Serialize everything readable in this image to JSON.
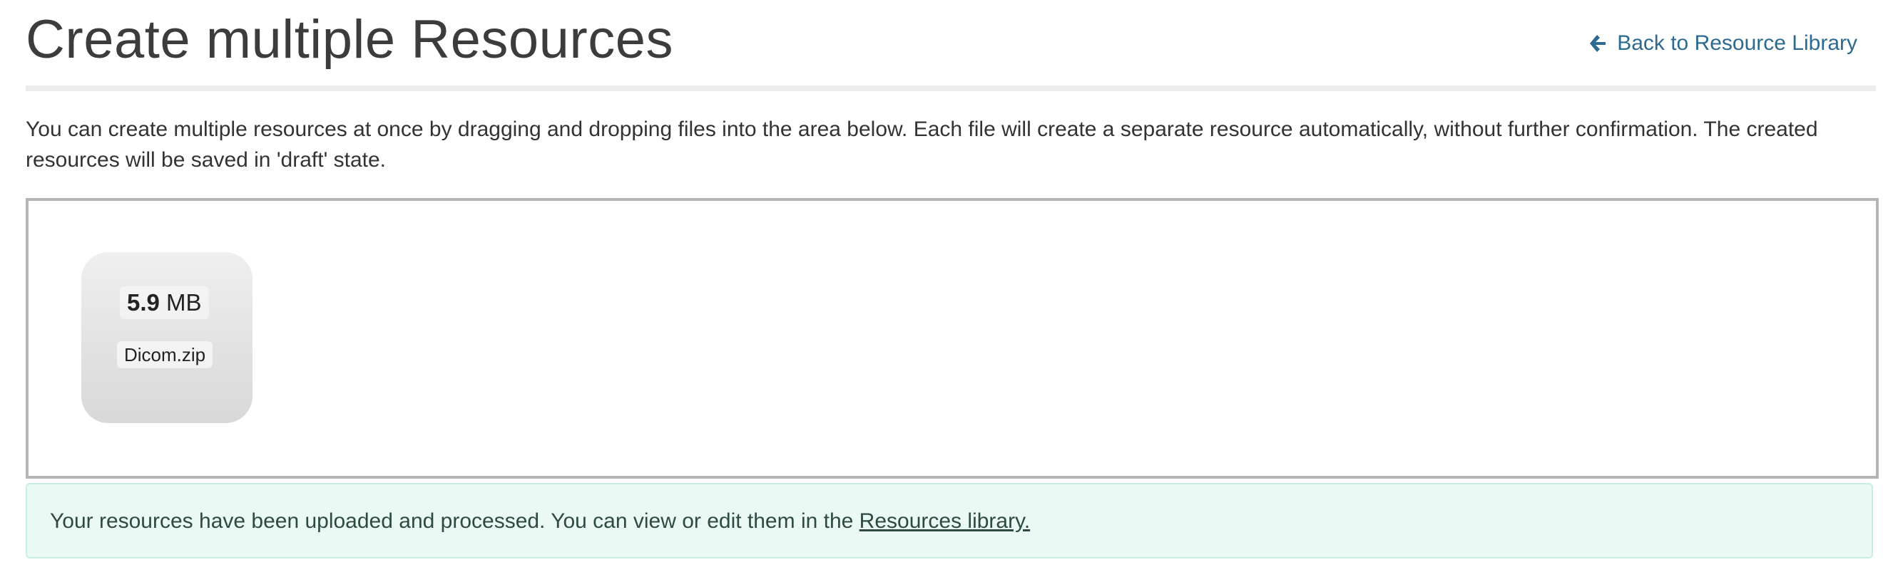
{
  "header": {
    "title": "Create multiple Resources",
    "back_link_label": "Back to Resource Library",
    "back_icon": "arrow-left-icon"
  },
  "intro": {
    "text": "You can create multiple resources at once by dragging and dropping files into the area below. Each file will create a separate resource automatically, without further confirmation. The created resources will be saved in 'draft' state."
  },
  "dropzone": {
    "files": [
      {
        "size_value": "5.9",
        "size_unit": "MB",
        "name": "Dicom.zip"
      }
    ]
  },
  "alert": {
    "text": "Your resources have been uploaded and processed. You can view or edit them in the ",
    "link_label": "Resources library.",
    "color_bg": "#ebf9f4",
    "color_border": "#c8eedf"
  },
  "colors": {
    "link": "#2d6a8f",
    "title": "#3c3c3c"
  }
}
